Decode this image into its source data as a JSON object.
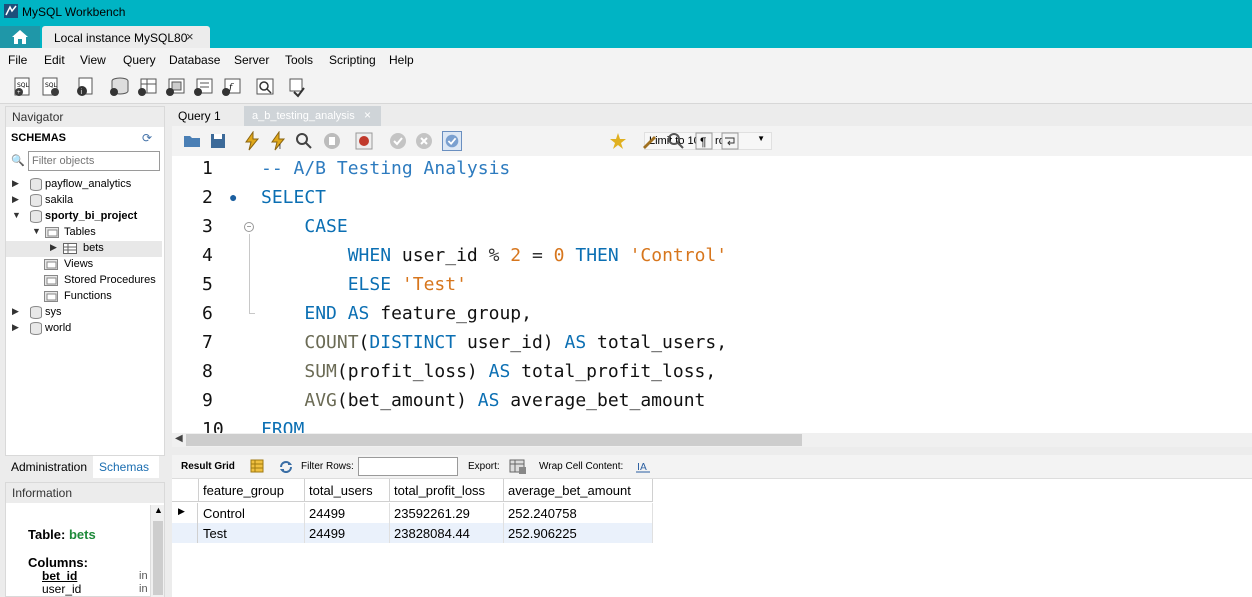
{
  "window": {
    "title": "MySQL Workbench"
  },
  "tabs": {
    "connection_label": "Local instance MySQL80",
    "close": "×"
  },
  "menu": [
    "File",
    "Edit",
    "View",
    "Query",
    "Database",
    "Server",
    "Tools",
    "Scripting",
    "Help"
  ],
  "navigator": {
    "header": "Navigator",
    "schemas_label": "SCHEMAS",
    "filter_placeholder": "Filter objects",
    "tree": [
      {
        "label": "payflow_analytics",
        "bold": false
      },
      {
        "label": "sakila",
        "bold": false
      },
      {
        "label": "sporty_bi_project",
        "bold": true
      },
      {
        "label": "Tables",
        "bold": false
      },
      {
        "label": "bets",
        "bold": false
      },
      {
        "label": "Views",
        "bold": false
      },
      {
        "label": "Stored Procedures",
        "bold": false
      },
      {
        "label": "Functions",
        "bold": false
      },
      {
        "label": "sys",
        "bold": false
      },
      {
        "label": "world",
        "bold": false
      }
    ],
    "bottom_tabs": [
      "Administration",
      "Schemas"
    ]
  },
  "information": {
    "header": "Information",
    "table_prefix": "Table:",
    "table_name": "bets",
    "columns_label": "Columns:",
    "columns": [
      {
        "name": "bet_id",
        "type": "in"
      },
      {
        "name": "user_id",
        "type": "in"
      }
    ]
  },
  "query_tabs": [
    "Query 1",
    "a_b_testing_analysis"
  ],
  "query_toolbar": {
    "limit": "Limit to 1000 rows"
  },
  "editor": {
    "line_numbers": [
      "1",
      "2",
      "3",
      "4",
      "5",
      "6",
      "7",
      "8",
      "9",
      "10"
    ]
  },
  "result_bar": {
    "result_grid": "Result Grid",
    "filter_rows": "Filter Rows:",
    "export": "Export:",
    "wrap": "Wrap Cell Content:"
  },
  "result_grid": {
    "columns": [
      "feature_group",
      "total_users",
      "total_profit_loss",
      "average_bet_amount"
    ],
    "rows": [
      [
        "Control",
        "24499",
        "23592261.29",
        "252.240758"
      ],
      [
        "Test",
        "24499",
        "23828084.44",
        "252.906225"
      ]
    ]
  },
  "colors": {
    "titlebar": "#00b4c4",
    "keyword": "#0b6fb3",
    "string": "#d7761d"
  }
}
